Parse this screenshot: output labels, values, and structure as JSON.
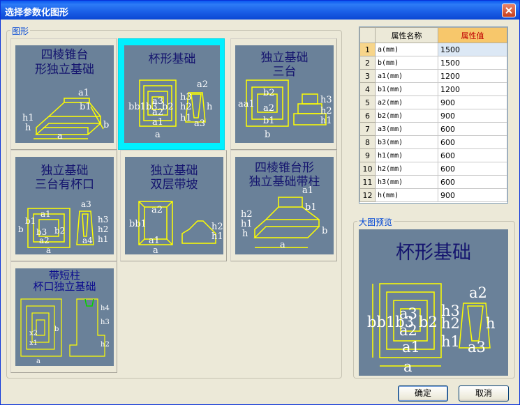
{
  "window": {
    "title": "选择参数化图形"
  },
  "gallery": {
    "label": "图形",
    "tiles": [
      {
        "id": "t1",
        "title": [
          "四棱锥台",
          "形独立基础"
        ],
        "selected": false
      },
      {
        "id": "t2",
        "title": [
          "杯形基础"
        ],
        "selected": true
      },
      {
        "id": "t3",
        "title": [
          "独立基础",
          "三台"
        ],
        "selected": false
      },
      {
        "id": "t4",
        "title": [
          "独立基础",
          "三台有杯口"
        ],
        "selected": false
      },
      {
        "id": "t5",
        "title": [
          "独立基础",
          "双层带坡"
        ],
        "selected": false
      },
      {
        "id": "t6",
        "title": [
          "四棱锥台形",
          "独立基础带柱"
        ],
        "selected": false
      },
      {
        "id": "t7",
        "title": [
          "带短柱",
          "杯口独立基础"
        ],
        "selected": false
      }
    ]
  },
  "properties": {
    "col_name": "属性名称",
    "col_value": "属性值",
    "rows": [
      {
        "idx": "1",
        "name": "a(mm)",
        "value": "1500"
      },
      {
        "idx": "2",
        "name": "b(mm)",
        "value": "1500"
      },
      {
        "idx": "3",
        "name": "a1(mm)",
        "value": "1200"
      },
      {
        "idx": "4",
        "name": "b1(mm)",
        "value": "1200"
      },
      {
        "idx": "5",
        "name": "a2(mm)",
        "value": "900"
      },
      {
        "idx": "6",
        "name": "b2(mm)",
        "value": "900"
      },
      {
        "idx": "7",
        "name": "a3(mm)",
        "value": "600"
      },
      {
        "idx": "8",
        "name": "b3(mm)",
        "value": "600"
      },
      {
        "idx": "9",
        "name": "h1(mm)",
        "value": "600"
      },
      {
        "idx": "10",
        "name": "h2(mm)",
        "value": "600"
      },
      {
        "idx": "11",
        "name": "h3(mm)",
        "value": "600"
      },
      {
        "idx": "12",
        "name": "h(mm)",
        "value": "900"
      }
    ],
    "selected_row": 0
  },
  "preview": {
    "label": "大图预览",
    "title": "杯形基础"
  },
  "buttons": {
    "ok": "确定",
    "cancel": "取消"
  },
  "colors": {
    "thumb_bg": "#6a8199",
    "line": "#ffff00",
    "title_text": "#14146e",
    "selection": "#00f0ff"
  }
}
